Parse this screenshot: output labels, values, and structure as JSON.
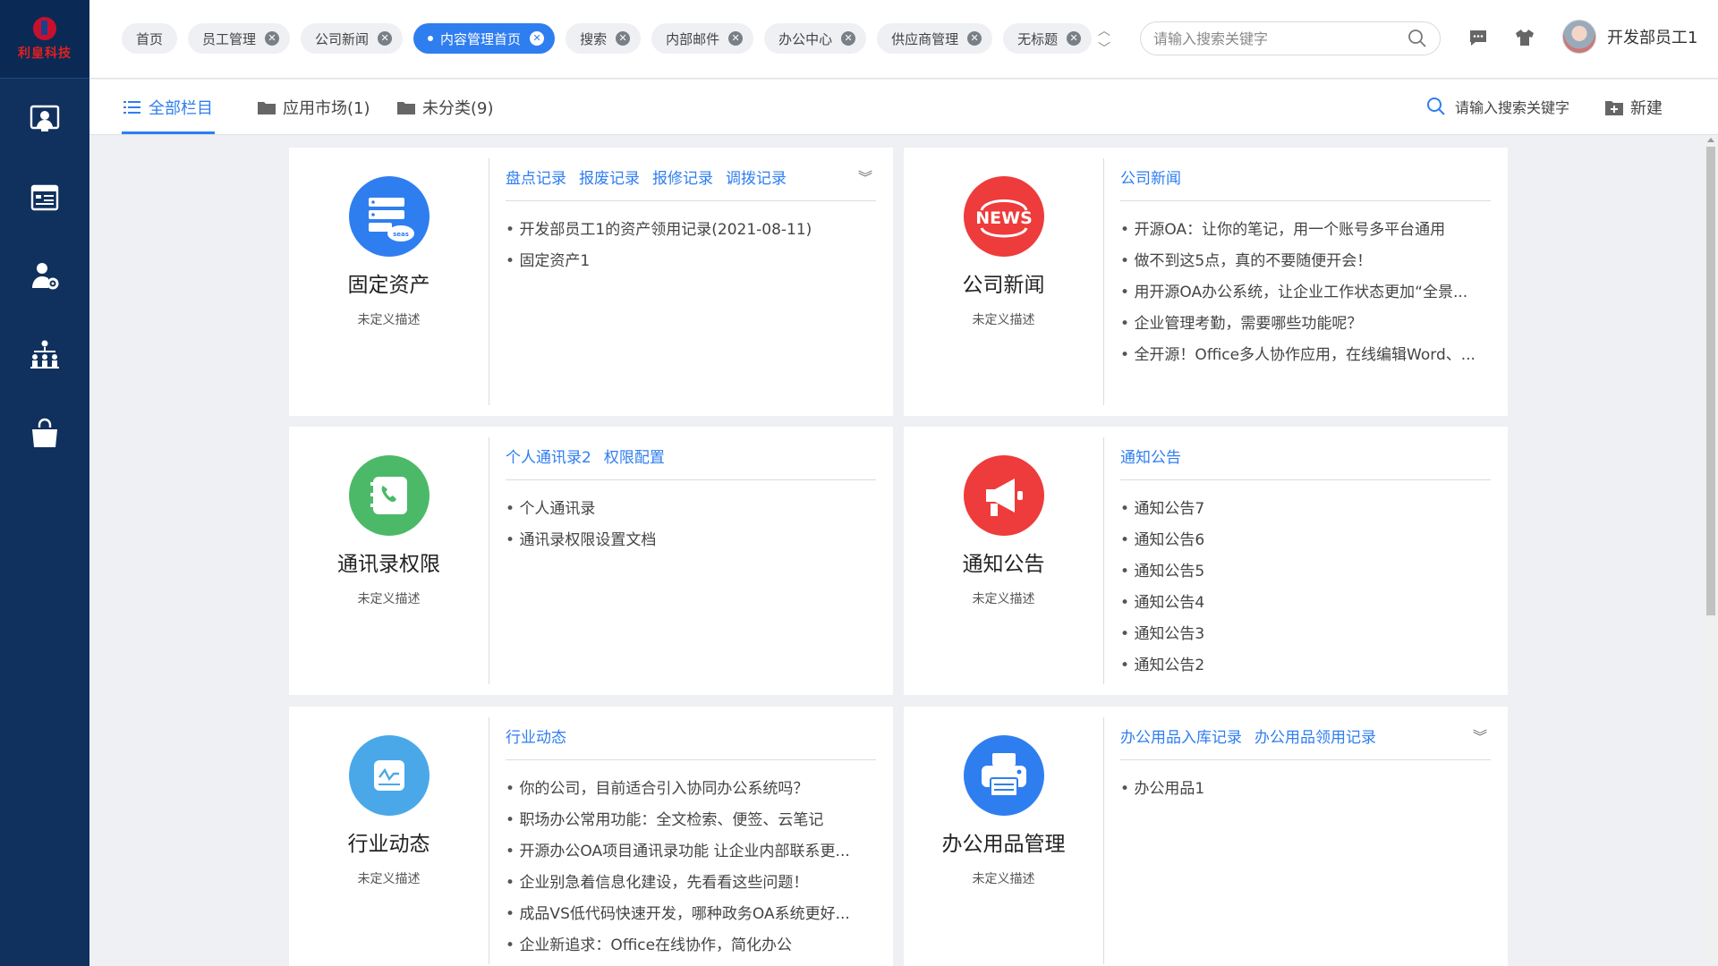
{
  "brand": {
    "logo_text": "利皇科技",
    "accent": "#2f7ef0",
    "sidebar_bg": "#10305e"
  },
  "sidebar": {
    "items": [
      {
        "icon": "user-card-icon"
      },
      {
        "icon": "calendar-icon"
      },
      {
        "icon": "user-settings-icon"
      },
      {
        "icon": "org-chart-icon"
      },
      {
        "icon": "shopping-bag-icon"
      }
    ]
  },
  "header": {
    "tabs": [
      {
        "label": "首页",
        "closable": false,
        "active": false
      },
      {
        "label": "员工管理",
        "closable": true,
        "active": false
      },
      {
        "label": "公司新闻",
        "closable": true,
        "active": false
      },
      {
        "label": "内容管理首页",
        "closable": true,
        "active": true
      },
      {
        "label": "搜索",
        "closable": true,
        "active": false
      },
      {
        "label": "内部邮件",
        "closable": true,
        "active": false
      },
      {
        "label": "办公中心",
        "closable": true,
        "active": false
      },
      {
        "label": "供应商管理",
        "closable": true,
        "active": false
      },
      {
        "label": "无标题",
        "closable": true,
        "active": false
      }
    ],
    "search_placeholder": "请输入搜索关键字",
    "user_name": "开发部员工1"
  },
  "subnav": {
    "tabs": [
      {
        "label": "全部栏目",
        "active": true
      },
      {
        "label": "应用市场(1)",
        "active": false
      },
      {
        "label": "未分类(9)",
        "active": false
      }
    ],
    "search_label": "请输入搜索关键字",
    "new_label": "新建"
  },
  "cards": [
    {
      "title": "固定资产",
      "desc": "未定义描述",
      "icon": "server-cloud-icon",
      "icon_color": "#2f7ef0",
      "links": [
        "盘点记录",
        "报废记录",
        "报修记录",
        "调拨记录"
      ],
      "has_expand": true,
      "items": [
        "开发部员工1的资产领用记录(2021-08-11)",
        "固定资产1"
      ]
    },
    {
      "title": "公司新闻",
      "desc": "未定义描述",
      "icon": "news-icon",
      "icon_color": "#ee3b3b",
      "icon_text": "NEWS",
      "links": [
        "公司新闻"
      ],
      "has_expand": false,
      "items": [
        "开源OA：让你的笔记，用一个账号多平台通用",
        "做不到这5点，真的不要随便开会！",
        "用开源OA办公系统，让企业工作状态更加“全景...",
        "企业管理考勤，需要哪些功能呢？",
        "全开源！Office多人协作应用，在线编辑Word、..."
      ]
    },
    {
      "title": "通讯录权限",
      "desc": "未定义描述",
      "icon": "phone-book-icon",
      "icon_color": "#4cb968",
      "links": [
        "个人通讯录2",
        "权限配置"
      ],
      "has_expand": false,
      "items": [
        "个人通讯录",
        "通讯录权限设置文档"
      ]
    },
    {
      "title": "通知公告",
      "desc": "未定义描述",
      "icon": "megaphone-icon",
      "icon_color": "#ee3b3b",
      "links": [
        "通知公告"
      ],
      "has_expand": false,
      "items": [
        "通知公告7",
        "通知公告6",
        "通知公告5",
        "通知公告4",
        "通知公告3",
        "通知公告2"
      ]
    },
    {
      "title": "行业动态",
      "desc": "未定义描述",
      "icon": "pulse-chart-icon",
      "icon_color": "#4aa8e8",
      "links": [
        "行业动态"
      ],
      "has_expand": false,
      "items": [
        "你的公司，目前适合引入协同办公系统吗？",
        "职场办公常用功能：全文检索、便签、云笔记",
        "开源办公OA项目通讯录功能 让企业内部联系更...",
        "企业别急着信息化建设，先看看这些问题！",
        "成品VS低代码快速开发，哪种政务OA系统更好...",
        "企业新追求：Office在线协作，简化办公"
      ]
    },
    {
      "title": "办公用品管理",
      "desc": "未定义描述",
      "icon": "printer-icon",
      "icon_color": "#2f7ef0",
      "links": [
        "办公用品入库记录",
        "办公用品领用记录"
      ],
      "has_expand": true,
      "items": [
        "办公用品1"
      ]
    }
  ]
}
